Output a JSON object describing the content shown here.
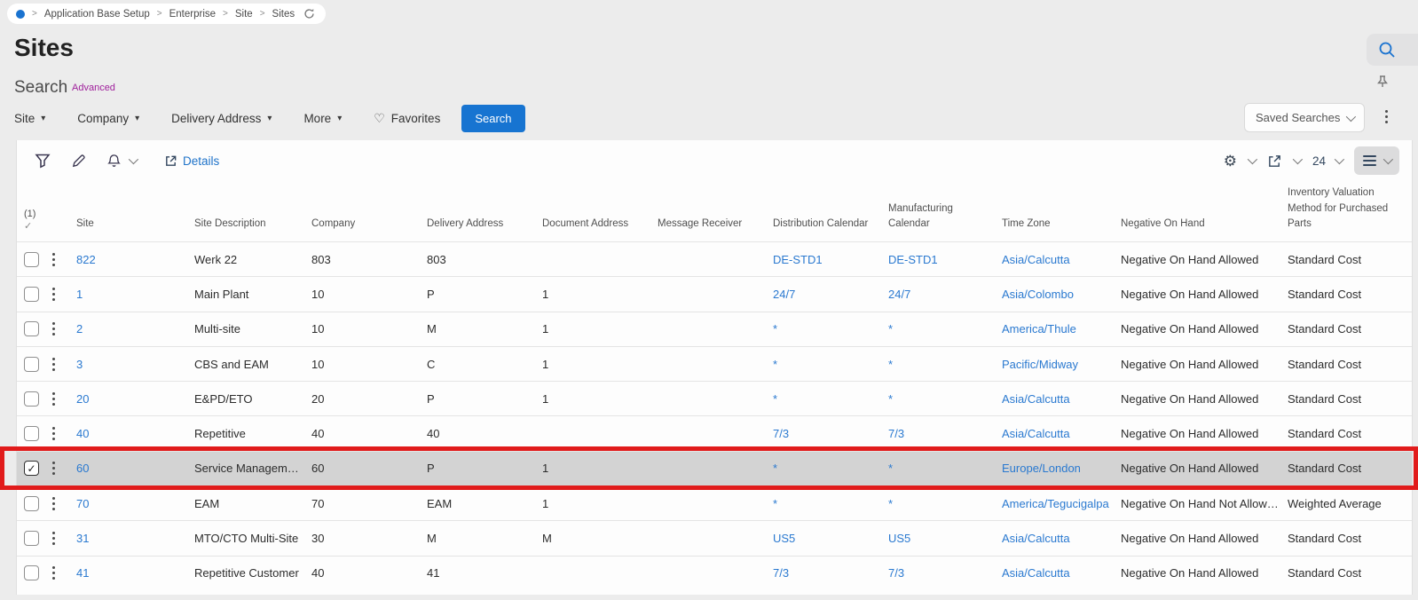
{
  "breadcrumb": {
    "separator": ">",
    "items": [
      "Application Base Setup",
      "Enterprise",
      "Site",
      "Sites"
    ]
  },
  "page": {
    "title": "Sites"
  },
  "search": {
    "label": "Search",
    "advanced_label": "Advanced"
  },
  "filters": {
    "dropdowns": {
      "site": "Site",
      "company": "Company",
      "delivery_address": "Delivery Address",
      "more": "More"
    },
    "caret_glyph": "▾",
    "favorites_label": "Favorites",
    "favorites_icon": "♡",
    "search_button_label": "Search",
    "saved_searches_label": "Saved Searches"
  },
  "toolbar": {
    "details_label": "Details",
    "gear_glyph": "⚙",
    "page_size": "24"
  },
  "table": {
    "selection_count": "(1)",
    "selection_check_glyph": "✓",
    "columns": {
      "site": "Site",
      "site_description": "Site Description",
      "company": "Company",
      "delivery_address": "Delivery Address",
      "document_address": "Document Address",
      "message_receiver": "Message Receiver",
      "distribution_calendar": "Distribution Calendar",
      "manufacturing_calendar": "Manufacturing Calendar",
      "time_zone": "Time Zone",
      "negative_on_hand": "Negative On Hand",
      "inventory_valuation": "Inventory Valuation Method for Purchased Parts"
    },
    "rows": [
      {
        "site": "822",
        "description": "Werk 22",
        "company": "803",
        "delivery_address": "803",
        "document_address": "",
        "message_receiver": "",
        "distribution_calendar": "DE-STD1",
        "manufacturing_calendar": "DE-STD1",
        "time_zone": "Asia/Calcutta",
        "negative_on_hand": "Negative On Hand Allowed",
        "inventory_valuation": "Standard Cost",
        "selected": false
      },
      {
        "site": "1",
        "description": "Main Plant",
        "company": "10",
        "delivery_address": "P",
        "document_address": "1",
        "message_receiver": "",
        "distribution_calendar": "24/7",
        "manufacturing_calendar": "24/7",
        "time_zone": "Asia/Colombo",
        "negative_on_hand": "Negative On Hand Allowed",
        "inventory_valuation": "Standard Cost",
        "selected": false
      },
      {
        "site": "2",
        "description": "Multi-site",
        "company": "10",
        "delivery_address": "M",
        "document_address": "1",
        "message_receiver": "",
        "distribution_calendar": "*",
        "manufacturing_calendar": "*",
        "time_zone": "America/Thule",
        "negative_on_hand": "Negative On Hand Allowed",
        "inventory_valuation": "Standard Cost",
        "selected": false
      },
      {
        "site": "3",
        "description": "CBS and EAM",
        "company": "10",
        "delivery_address": "C",
        "document_address": "1",
        "message_receiver": "",
        "distribution_calendar": "*",
        "manufacturing_calendar": "*",
        "time_zone": "Pacific/Midway",
        "negative_on_hand": "Negative On Hand Allowed",
        "inventory_valuation": "Standard Cost",
        "selected": false
      },
      {
        "site": "20",
        "description": "E&PD/ETO",
        "company": "20",
        "delivery_address": "P",
        "document_address": "1",
        "message_receiver": "",
        "distribution_calendar": "*",
        "manufacturing_calendar": "*",
        "time_zone": "Asia/Calcutta",
        "negative_on_hand": "Negative On Hand Allowed",
        "inventory_valuation": "Standard Cost",
        "selected": false
      },
      {
        "site": "40",
        "description": "Repetitive",
        "company": "40",
        "delivery_address": "40",
        "document_address": "",
        "message_receiver": "",
        "distribution_calendar": "7/3",
        "manufacturing_calendar": "7/3",
        "time_zone": "Asia/Calcutta",
        "negative_on_hand": "Negative On Hand Allowed",
        "inventory_valuation": "Standard Cost",
        "selected": false
      },
      {
        "site": "60",
        "description": "Service Management",
        "company": "60",
        "delivery_address": "P",
        "document_address": "1",
        "message_receiver": "",
        "distribution_calendar": "*",
        "manufacturing_calendar": "*",
        "time_zone": "Europe/London",
        "negative_on_hand": "Negative On Hand Allowed",
        "inventory_valuation": "Standard Cost",
        "selected": true
      },
      {
        "site": "70",
        "description": "EAM",
        "company": "70",
        "delivery_address": "EAM",
        "document_address": "1",
        "message_receiver": "",
        "distribution_calendar": "*",
        "manufacturing_calendar": "*",
        "time_zone": "America/Tegucigalpa",
        "negative_on_hand": "Negative On Hand Not Allowed",
        "inventory_valuation": "Weighted Average",
        "selected": false
      },
      {
        "site": "31",
        "description": "MTO/CTO Multi-Site",
        "company": "30",
        "delivery_address": "M",
        "document_address": "M",
        "message_receiver": "",
        "distribution_calendar": "US5",
        "manufacturing_calendar": "US5",
        "time_zone": "Asia/Calcutta",
        "negative_on_hand": "Negative On Hand Allowed",
        "inventory_valuation": "Standard Cost",
        "selected": false
      },
      {
        "site": "41",
        "description": "Repetitive Customer",
        "company": "40",
        "delivery_address": "41",
        "document_address": "",
        "message_receiver": "",
        "distribution_calendar": "7/3",
        "manufacturing_calendar": "7/3",
        "time_zone": "Asia/Calcutta",
        "negative_on_hand": "Negative On Hand Allowed",
        "inventory_valuation": "Standard Cost",
        "selected": false
      }
    ]
  },
  "colors": {
    "accent_blue": "#1774d1",
    "link_blue": "#2a79d0",
    "advanced_purple": "#a0219c",
    "annotation_red": "#e11b1b",
    "selected_row_bg": "#d3d3d3",
    "page_bg": "#ececec"
  }
}
